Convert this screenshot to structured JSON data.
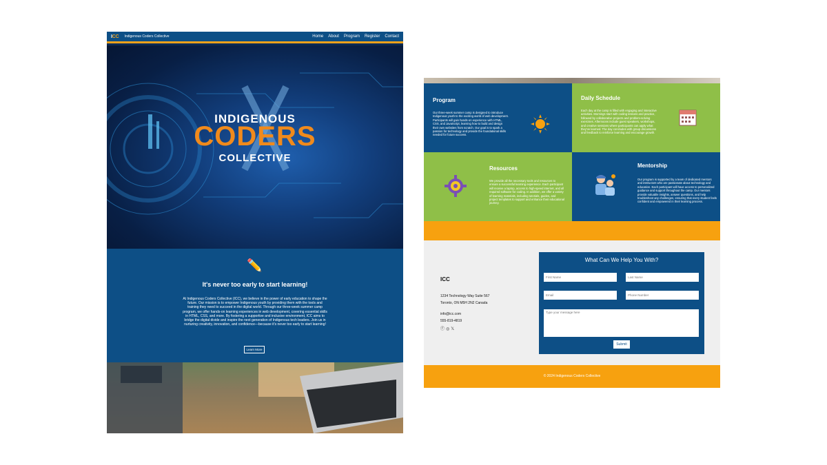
{
  "landing": {
    "nav": {
      "logo_prefix": "I",
      "logo_suffix": "CC",
      "brand": "Indigenous Coders Collective",
      "links": [
        "Home",
        "About",
        "Program",
        "Register",
        "Contact"
      ]
    },
    "hero": {
      "line1": "INDIGENOUS",
      "line2": "CODERS",
      "line3": "COLLECTIVE"
    },
    "intro": {
      "heading": "It's never too early to start learning!",
      "body": "At Indigenous Coders Collective (ICC), we believe in the power of early education to shape the future. Our mission is to empower Indigenous youth by providing them with the tools and training they need to succeed in the digital world. Through our three-week summer camp program, we offer hands-on learning experiences in web development, covering essential skills in HTML, CSS, and more. By fostering a supportive and inclusive environment, ICC aims to bridge the digital divide and inspire the next generation of Indigenous tech leaders. Join us in nurturing creativity, innovation, and confidence—because it's never too early to start learning!",
      "button": "Learn More"
    }
  },
  "program_page": {
    "cards": {
      "program": {
        "title": "Program",
        "body": "Our three-week summer camp is designed to introduce Indigenous youth to the exciting world of web development. Participants will gain hands-on experience with HTML, CSS, and JavaScript, learning how to build and design their own websites from scratch. Our goal is to spark a passion for technology and provide the foundational skills needed for future success.",
        "icon": "sun-icon"
      },
      "schedule": {
        "title": "Daily Schedule",
        "body": "Each day at the camp is filled with engaging and interactive activities. Mornings start with coding lessons and practice, followed by collaborative projects and problem-solving exercises. Afternoons include guest speakers, workshops, and creative sessions where participants can apply what they've learned. The day concludes with group discussions and feedback to reinforce learning and encourage growth.",
        "icon": "calendar-icon"
      },
      "resources": {
        "title": "Resources",
        "body": "We provide all the necessary tools and resources to ensure a successful learning experience. Each participant will receive a laptop, access to high-speed internet, and all required software for coding. In addition, we offer a variety of learning materials, including tutorials, guides, and project templates to support and enhance their educational journey.",
        "icon": "gear-icon"
      },
      "mentorship": {
        "title": "Mentorship",
        "body": "Our program is supported by a team of dedicated mentors and instructors who are passionate about technology and education. Each participant will have access to personalized guidance and support throughout the camp. Our mentors provide valuable insights, answer questions, and help troubleshoot any challenges, ensuring that every student feels confident and empowered in their learning process.",
        "icon": "mentor-icon"
      }
    },
    "contact": {
      "org": "ICC",
      "address1": "1234 Technology Way Suite 567",
      "address2": "Toronto, ON M5H 2N2 Canada",
      "email": "info@icc.com",
      "phone": "555-819-4819"
    },
    "form": {
      "title": "What Can We Help You With?",
      "first_name": "First Name",
      "last_name": "Last Name",
      "email": "Email",
      "phone": "Phone Number",
      "message": "Type your message here",
      "submit": "Submit"
    },
    "footer": "© 2024 Indigenous Coders Collective"
  },
  "colors": {
    "blue": "#0d4f86",
    "green": "#8fbf48",
    "orange": "#f7a10f",
    "coders_orange": "#f08a1c"
  }
}
